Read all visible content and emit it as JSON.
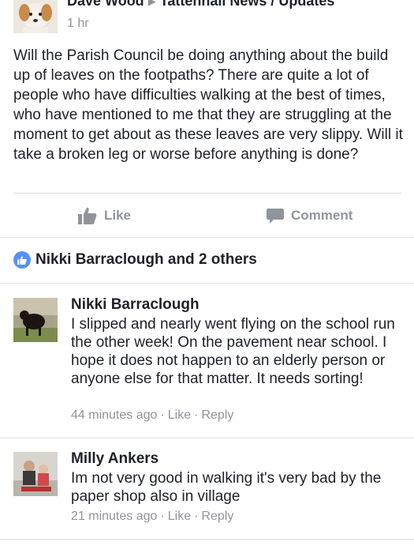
{
  "post": {
    "author": "Dave Wood",
    "group": "Tattenhall News / Updates",
    "time": "1 hr",
    "body": "Will the Parish Council be doing anything about the build up of leaves on the footpaths? There are quite a lot of people who have difficulties walking at the best of times, who have mentioned to me that they are struggling at the moment to get about as these leaves are very slippy. Will it take a broken leg or worse before anything is done?"
  },
  "actions": {
    "like_label": "Like",
    "comment_label": "Comment"
  },
  "reactions": {
    "summary": "Nikki Barraclough and 2 others"
  },
  "comments": [
    {
      "author": "Nikki Barraclough",
      "text": "I slipped and nearly went flying on the school run the other week! On the pavement  near school. I hope it does not happen to an elderly person or anyone else for that matter. It needs sorting!",
      "time": "44 minutes ago",
      "like_label": "Like",
      "reply_label": "Reply"
    },
    {
      "author": "Milly Ankers",
      "text": "Im not very good in walking it's very bad by the paper shop also in  village",
      "time": "21 minutes ago",
      "like_label": "Like",
      "reply_label": "Reply"
    }
  ],
  "colors": {
    "text": "#1d2129",
    "secondary": "#90949c",
    "like_blue": "#5890ff",
    "divider": "#dddfe2"
  },
  "icons": [
    "thumbs-up-icon",
    "comment-bubble-icon",
    "like-reaction-icon",
    "chevron-down-icon",
    "triangle-arrow-icon"
  ]
}
